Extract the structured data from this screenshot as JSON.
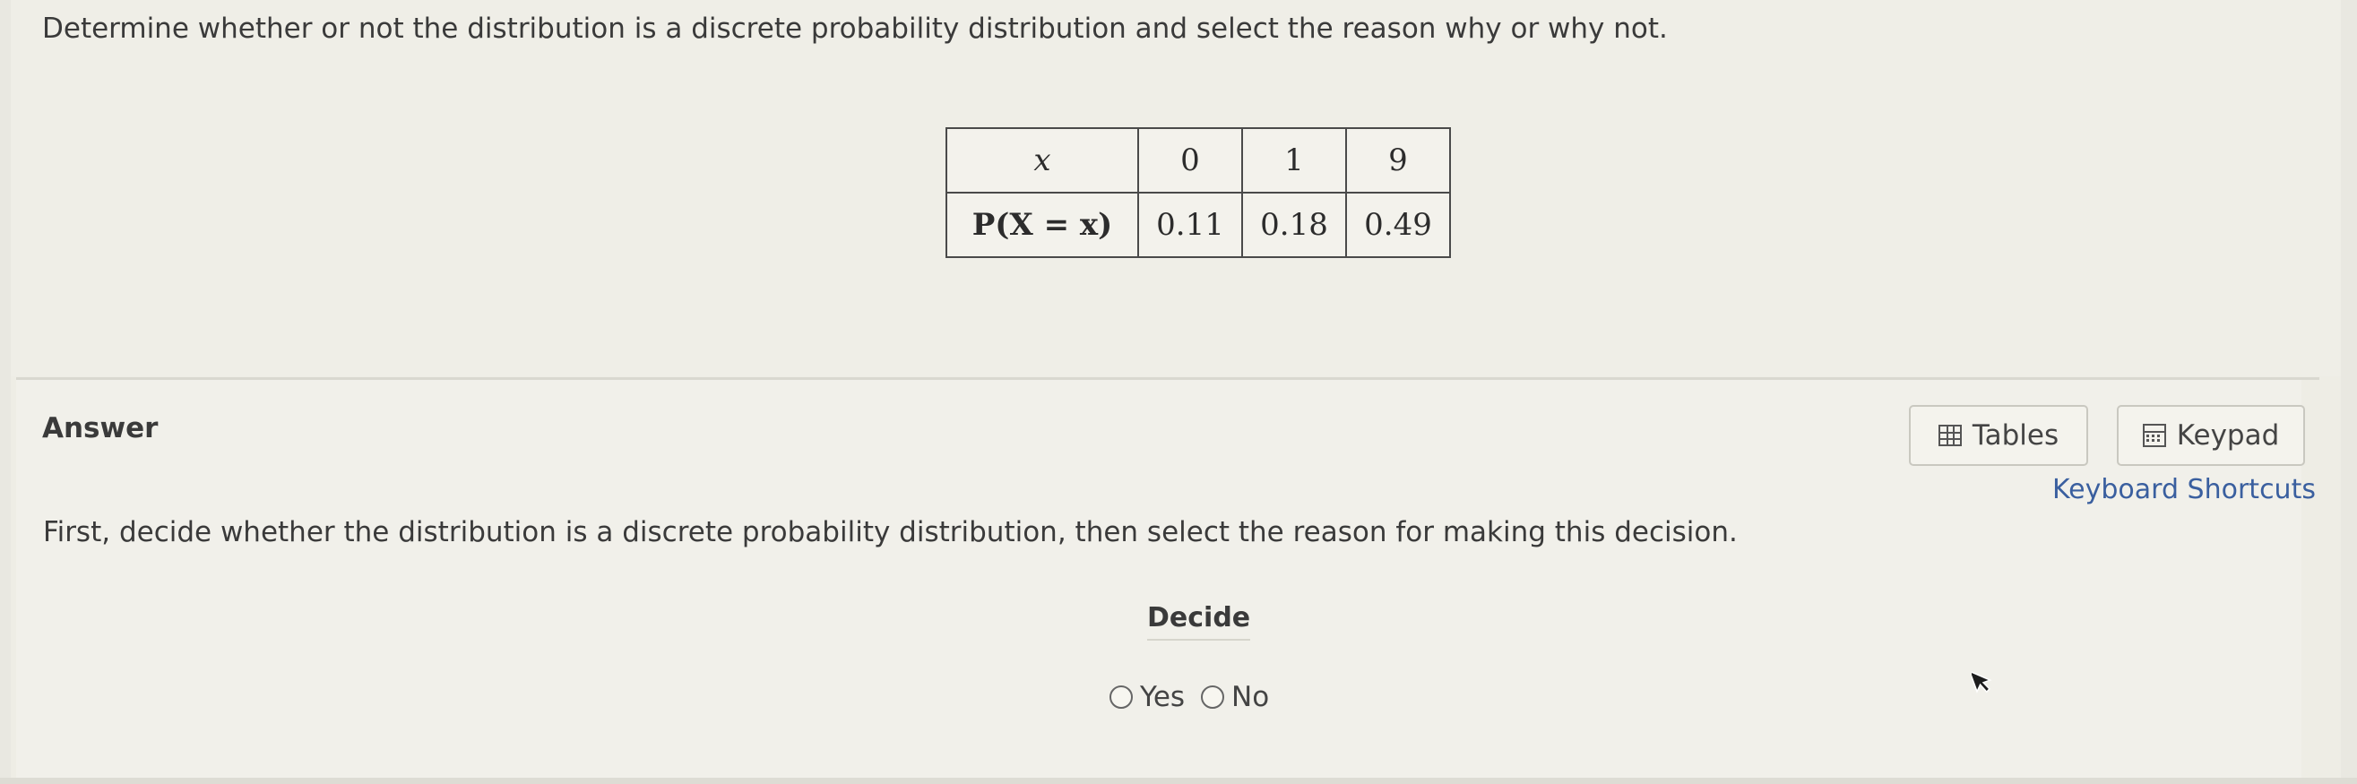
{
  "question": {
    "text": "Determine whether or not the distribution is a discrete probability distribution and select the reason why or why not."
  },
  "distribution_table": {
    "row_header_x": "x",
    "row_header_p": "P(X = x)",
    "x_values": [
      "0",
      "1",
      "9"
    ],
    "p_values": [
      "0.11",
      "0.18",
      "0.49"
    ]
  },
  "answer": {
    "label": "Answer",
    "tables_button": "Tables",
    "keypad_button": "Keypad",
    "keyboard_shortcuts": "Keyboard Shortcuts",
    "instruction": "First, decide whether the distribution is a discrete probability distribution, then select the reason for making this decision.",
    "decide_label": "Decide",
    "options": [
      "Yes",
      "No"
    ]
  },
  "icons": {
    "tables": "table-grid-icon",
    "keypad": "keypad-icon",
    "radio": "radio-circle-icon",
    "cursor": "mouse-pointer-icon"
  }
}
